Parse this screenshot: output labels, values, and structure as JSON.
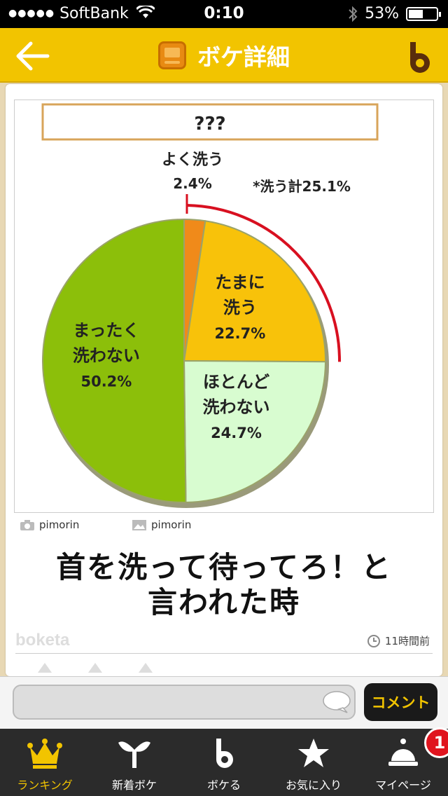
{
  "status_bar": {
    "carrier": "SoftBank",
    "time": "0:10",
    "battery": "53%",
    "battery_level": 0.53
  },
  "header": {
    "title": "ボケ詳細"
  },
  "post": {
    "image": {
      "title_box": "???",
      "total_note": "*洗う計25.1%",
      "chart_data": {
        "type": "pie",
        "title": "???",
        "start_angle": "top, clockwise",
        "slices": [
          {
            "label_lines": [
              "よく洗う"
            ],
            "value": 2.4,
            "value_label": "2.4%",
            "color": "#f08a1a"
          },
          {
            "label_lines": [
              "たまに",
              "洗う"
            ],
            "value": 22.7,
            "value_label": "22.7%",
            "color": "#f8c20a"
          },
          {
            "label_lines": [
              "ほとんど",
              "洗わない"
            ],
            "value": 24.7,
            "value_label": "24.7%",
            "color": "#d8fcd0"
          },
          {
            "label_lines": [
              "まったく",
              "洗わない"
            ],
            "value": 50.2,
            "value_label": "50.2%",
            "color": "#8cbf0a"
          }
        ],
        "annotation": "*洗う計25.1%",
        "annotation_arc_color": "#d81020"
      }
    },
    "photo_credit": "pimorin",
    "image_credit": "pimorin",
    "caption_lines": [
      "首を洗って待ってろ！と",
      "言われた時"
    ],
    "watermark": "boketa",
    "posted_ago": "11時間前"
  },
  "comment": {
    "placeholder": "",
    "button_label": "コメント"
  },
  "tabs": [
    {
      "label": "ランキング",
      "icon": "crown-icon",
      "active": true
    },
    {
      "label": "新着ボケ",
      "icon": "sprout-icon",
      "active": false
    },
    {
      "label": "ボケる",
      "icon": "boketa-b-icon",
      "active": false
    },
    {
      "label": "お気に入り",
      "icon": "star-icon",
      "active": false
    },
    {
      "label": "マイページ",
      "icon": "bell-icon",
      "active": false,
      "badge": "1"
    }
  ],
  "colors": {
    "header_yellow": "#f2c400",
    "tab_active": "#f2c400",
    "badge_red": "#e0141e"
  }
}
